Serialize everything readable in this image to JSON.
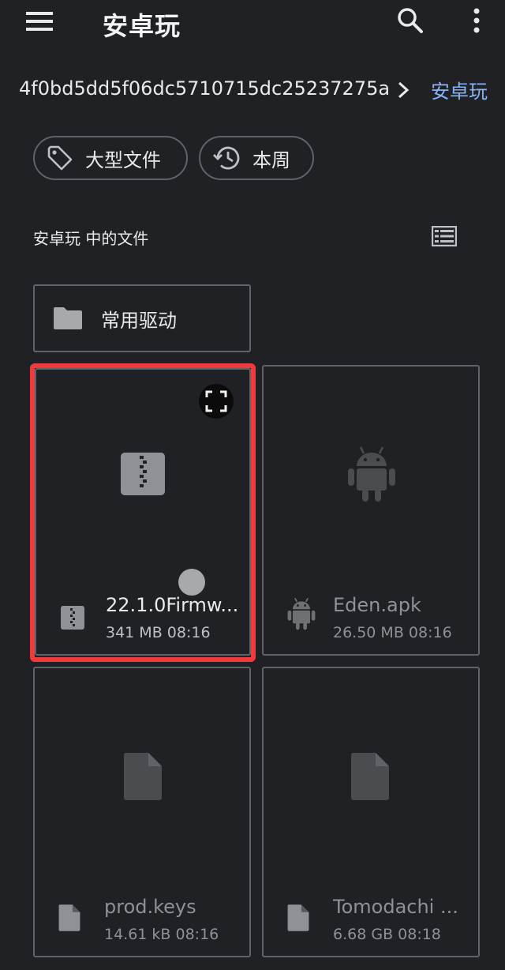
{
  "app_bar": {
    "title": "安卓玩",
    "menu_icon": "hamburger-menu-icon",
    "search_icon": "search-icon",
    "more_icon": "more-vert-icon"
  },
  "breadcrumb": {
    "parent": "4f0bd5dd5f06dc5710715dc25237275a",
    "current": "安卓玩"
  },
  "chips": [
    {
      "label": "大型文件",
      "icon": "tag-icon"
    },
    {
      "label": "本周",
      "icon": "history-icon"
    }
  ],
  "section": {
    "title": "安卓玩 中的文件",
    "view_toggle_icon": "list-view-icon"
  },
  "folders": [
    {
      "name": "常用驱动",
      "icon": "folder-icon"
    }
  ],
  "files": [
    {
      "name": "22.1.0Firmw...",
      "size": "341 MB",
      "time": "08:16",
      "meta": "341 MB 08:16",
      "icon": "archive-zip-icon",
      "selected": true
    },
    {
      "name": "Eden.apk",
      "size": "26.50 MB",
      "time": "08:16",
      "meta": "26.50 MB 08:16",
      "icon": "android-icon",
      "selected": false
    },
    {
      "name": "prod.keys",
      "size": "14.61 kB",
      "time": "08:16",
      "meta": "14.61 kB 08:16",
      "icon": "document-icon",
      "selected": false
    },
    {
      "name": "Tomodachi ...",
      "size": "6.68 GB",
      "time": "08:18",
      "meta": "6.68 GB 08:18",
      "icon": "document-icon",
      "selected": false
    }
  ],
  "colors": {
    "background": "#202124",
    "accent": "#8ab4f8",
    "highlight": "#ef3b3b",
    "border": "#5f6368"
  }
}
